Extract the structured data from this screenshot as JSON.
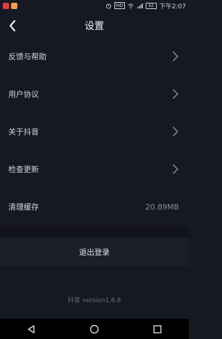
{
  "status_bar": {
    "time": "下午2:07",
    "battery": "62",
    "network": "HD"
  },
  "header": {
    "title": "设置",
    "back_icon": "chevron-left-icon"
  },
  "settings": {
    "items": [
      {
        "label": "反馈与帮助",
        "icon": "chevron-right-icon"
      },
      {
        "label": "用户协议",
        "icon": "chevron-right-icon"
      },
      {
        "label": "关于抖音",
        "icon": "chevron-right-icon"
      },
      {
        "label": "检查更新",
        "icon": "chevron-right-icon"
      },
      {
        "label": "清理缓存",
        "value": "20.89MB"
      }
    ]
  },
  "logout": {
    "label": "退出登录"
  },
  "footer": {
    "version": "抖音 version1.6.8"
  },
  "colors": {
    "background": "#161824",
    "section_gap": "#12131d",
    "logout_bar": "#1c1e2a",
    "text_primary": "#e6e6ea",
    "text_secondary": "#8a8b95",
    "version_text": "#6d6e79"
  },
  "nav_bar": {
    "buttons": [
      "back-triangle-icon",
      "home-circle-icon",
      "recents-square-icon"
    ]
  }
}
